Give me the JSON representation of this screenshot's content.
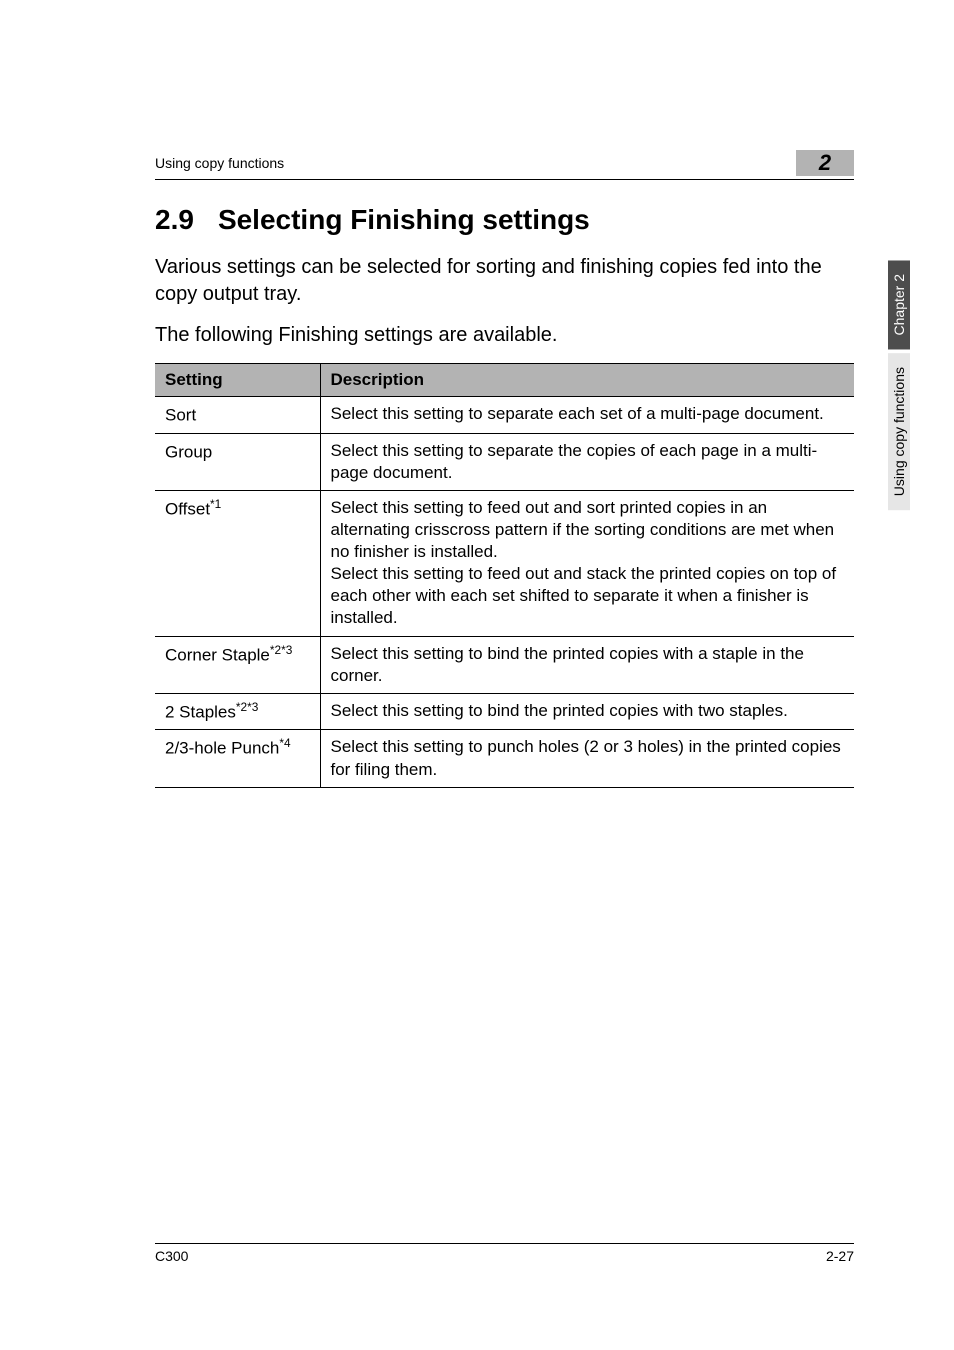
{
  "header": {
    "running_head": "Using copy functions",
    "chapter_badge": "2"
  },
  "section": {
    "number": "2.9",
    "title": "Selecting Finishing settings"
  },
  "intro": [
    "Various settings can be selected for sorting and finishing copies fed into the copy output tray.",
    "The following Finishing settings are available."
  ],
  "table": {
    "headers": [
      "Setting",
      "Description"
    ],
    "rows": [
      {
        "setting": "Sort",
        "setting_sup": "",
        "description": "Select this setting to separate each set of a multi-page document."
      },
      {
        "setting": "Group",
        "setting_sup": "",
        "description": "Select this setting to separate the copies of each page in a multi-page document."
      },
      {
        "setting": "Offset",
        "setting_sup": "*1",
        "description": "Select this setting to feed out and sort printed copies in an alternating crisscross pattern if the sorting conditions are met when no finisher is installed.\nSelect this setting to feed out and stack the printed copies on top of each other with each set shifted to separate it when a finisher is installed."
      },
      {
        "setting": "Corner Staple",
        "setting_sup": "*2*3",
        "description": "Select this setting to bind the printed copies with a staple in the corner."
      },
      {
        "setting": "2 Staples",
        "setting_sup": "*2*3",
        "description": "Select this setting to bind the printed copies with two staples."
      },
      {
        "setting": "2/3-hole Punch",
        "setting_sup": "*4",
        "description": "Select this setting to punch holes (2 or 3 holes) in the printed copies for filing them."
      }
    ]
  },
  "side_tabs": {
    "dark": "Chapter 2",
    "light": "Using copy functions"
  },
  "footer": {
    "left": "C300",
    "right": "2-27"
  }
}
